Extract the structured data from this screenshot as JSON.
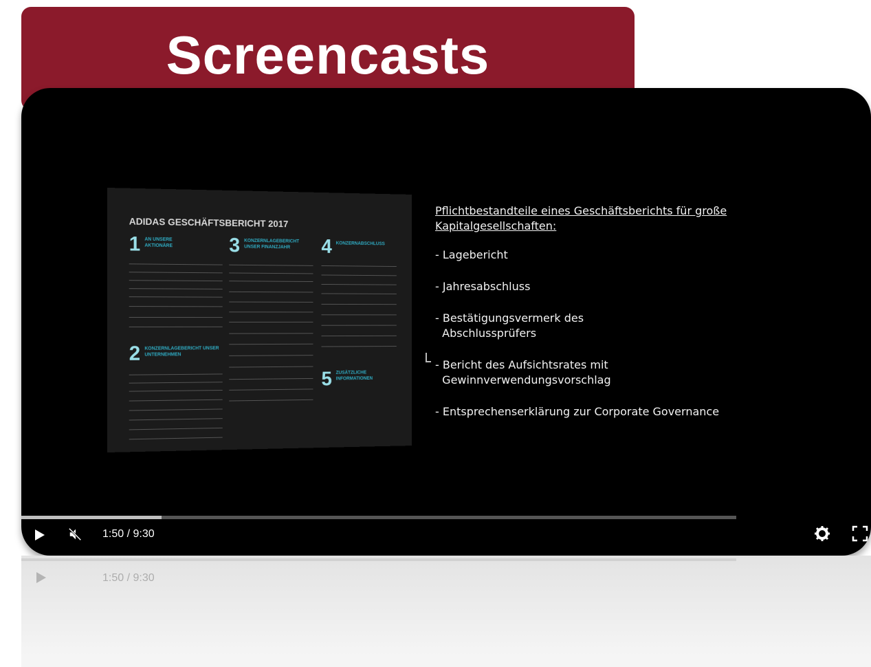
{
  "banner": {
    "title": "Screencasts"
  },
  "video": {
    "report": {
      "title": "ADIDAS GESCHÄFTSBERICHT 2017",
      "sections": [
        {
          "num": "1",
          "label": "AN UNSERE AKTIONÄRE"
        },
        {
          "num": "2",
          "label": "KONZERNLAGEBERICHT UNSER UNTERNEHMEN"
        },
        {
          "num": "3",
          "label": "KONZERNLAGEBERICHT UNSER FINANZJAHR"
        },
        {
          "num": "4",
          "label": "KONZERNABSCHLUSS"
        },
        {
          "num": "5",
          "label": "ZUSÄTZLICHE INFORMATIONEN"
        }
      ]
    },
    "slide": {
      "heading_line1": "Pflichtbestandteile eines Geschäftsberichts für große",
      "heading_line2": "Kapitalgesellschaften:",
      "bullets": [
        "- Lagebericht",
        "- Jahresabschluss",
        "- Bestätigungsvermerk des\n  Abschlussprüfers",
        "- Bericht des Aufsichtsrates mit\n  Gewinnverwendungsvorschlag",
        "- Entsprechenserklärung zur Corporate Governance"
      ]
    },
    "progress": 0.196,
    "time": "1:50 / 9:30",
    "icons": [
      "play-icon",
      "mute-icon",
      "gear-icon",
      "fullscreen-icon"
    ],
    "colors": {
      "banner": "#8b1a2b",
      "player_bg": "#000000",
      "accent": "#2fa9c0"
    }
  }
}
